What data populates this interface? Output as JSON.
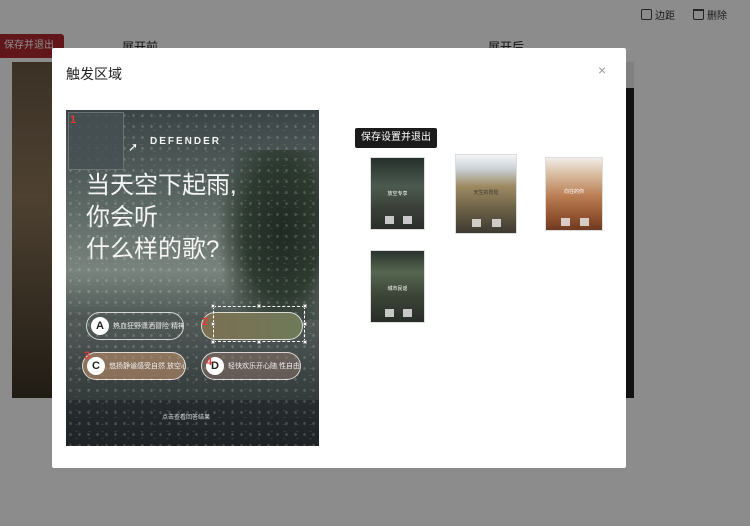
{
  "toolbar": {
    "border_label": "边距",
    "delete_label": "删除"
  },
  "page": {
    "save_exit_label": "保存并退出",
    "col_before": "展开前",
    "col_after": "展开后"
  },
  "modal": {
    "title": "触发区域",
    "close_glyph": "×",
    "poster": {
      "brand": "DEFENDER",
      "headline": [
        "当天空下起雨,",
        "你会听",
        "什么样的歌?"
      ],
      "options": [
        {
          "letter": "A",
          "text": "热血狂野潇洒冒险 精神的摇滚乐?"
        },
        {
          "letter": "B",
          "text": ""
        },
        {
          "letter": "C",
          "text": "悠扬静谧感受自然 放空心情的民谣?"
        },
        {
          "letter": "D",
          "text": "轻快欢乐开心随 性自由的流行?"
        }
      ],
      "footer": "点击查看回答结果",
      "marks": [
        "1",
        "2",
        "3",
        "4"
      ]
    },
    "tooltip": "保存设置并退出",
    "thumbnails": [
      {
        "label": "放空专享"
      },
      {
        "label": "天生的冒险"
      },
      {
        "label": "向往的你"
      },
      {
        "label": "城市民谣"
      }
    ]
  },
  "colors": {
    "accent_red": "#b12a2e",
    "mark_red": "#e23b3b",
    "mask": "rgba(0,0,0,0.45)"
  }
}
